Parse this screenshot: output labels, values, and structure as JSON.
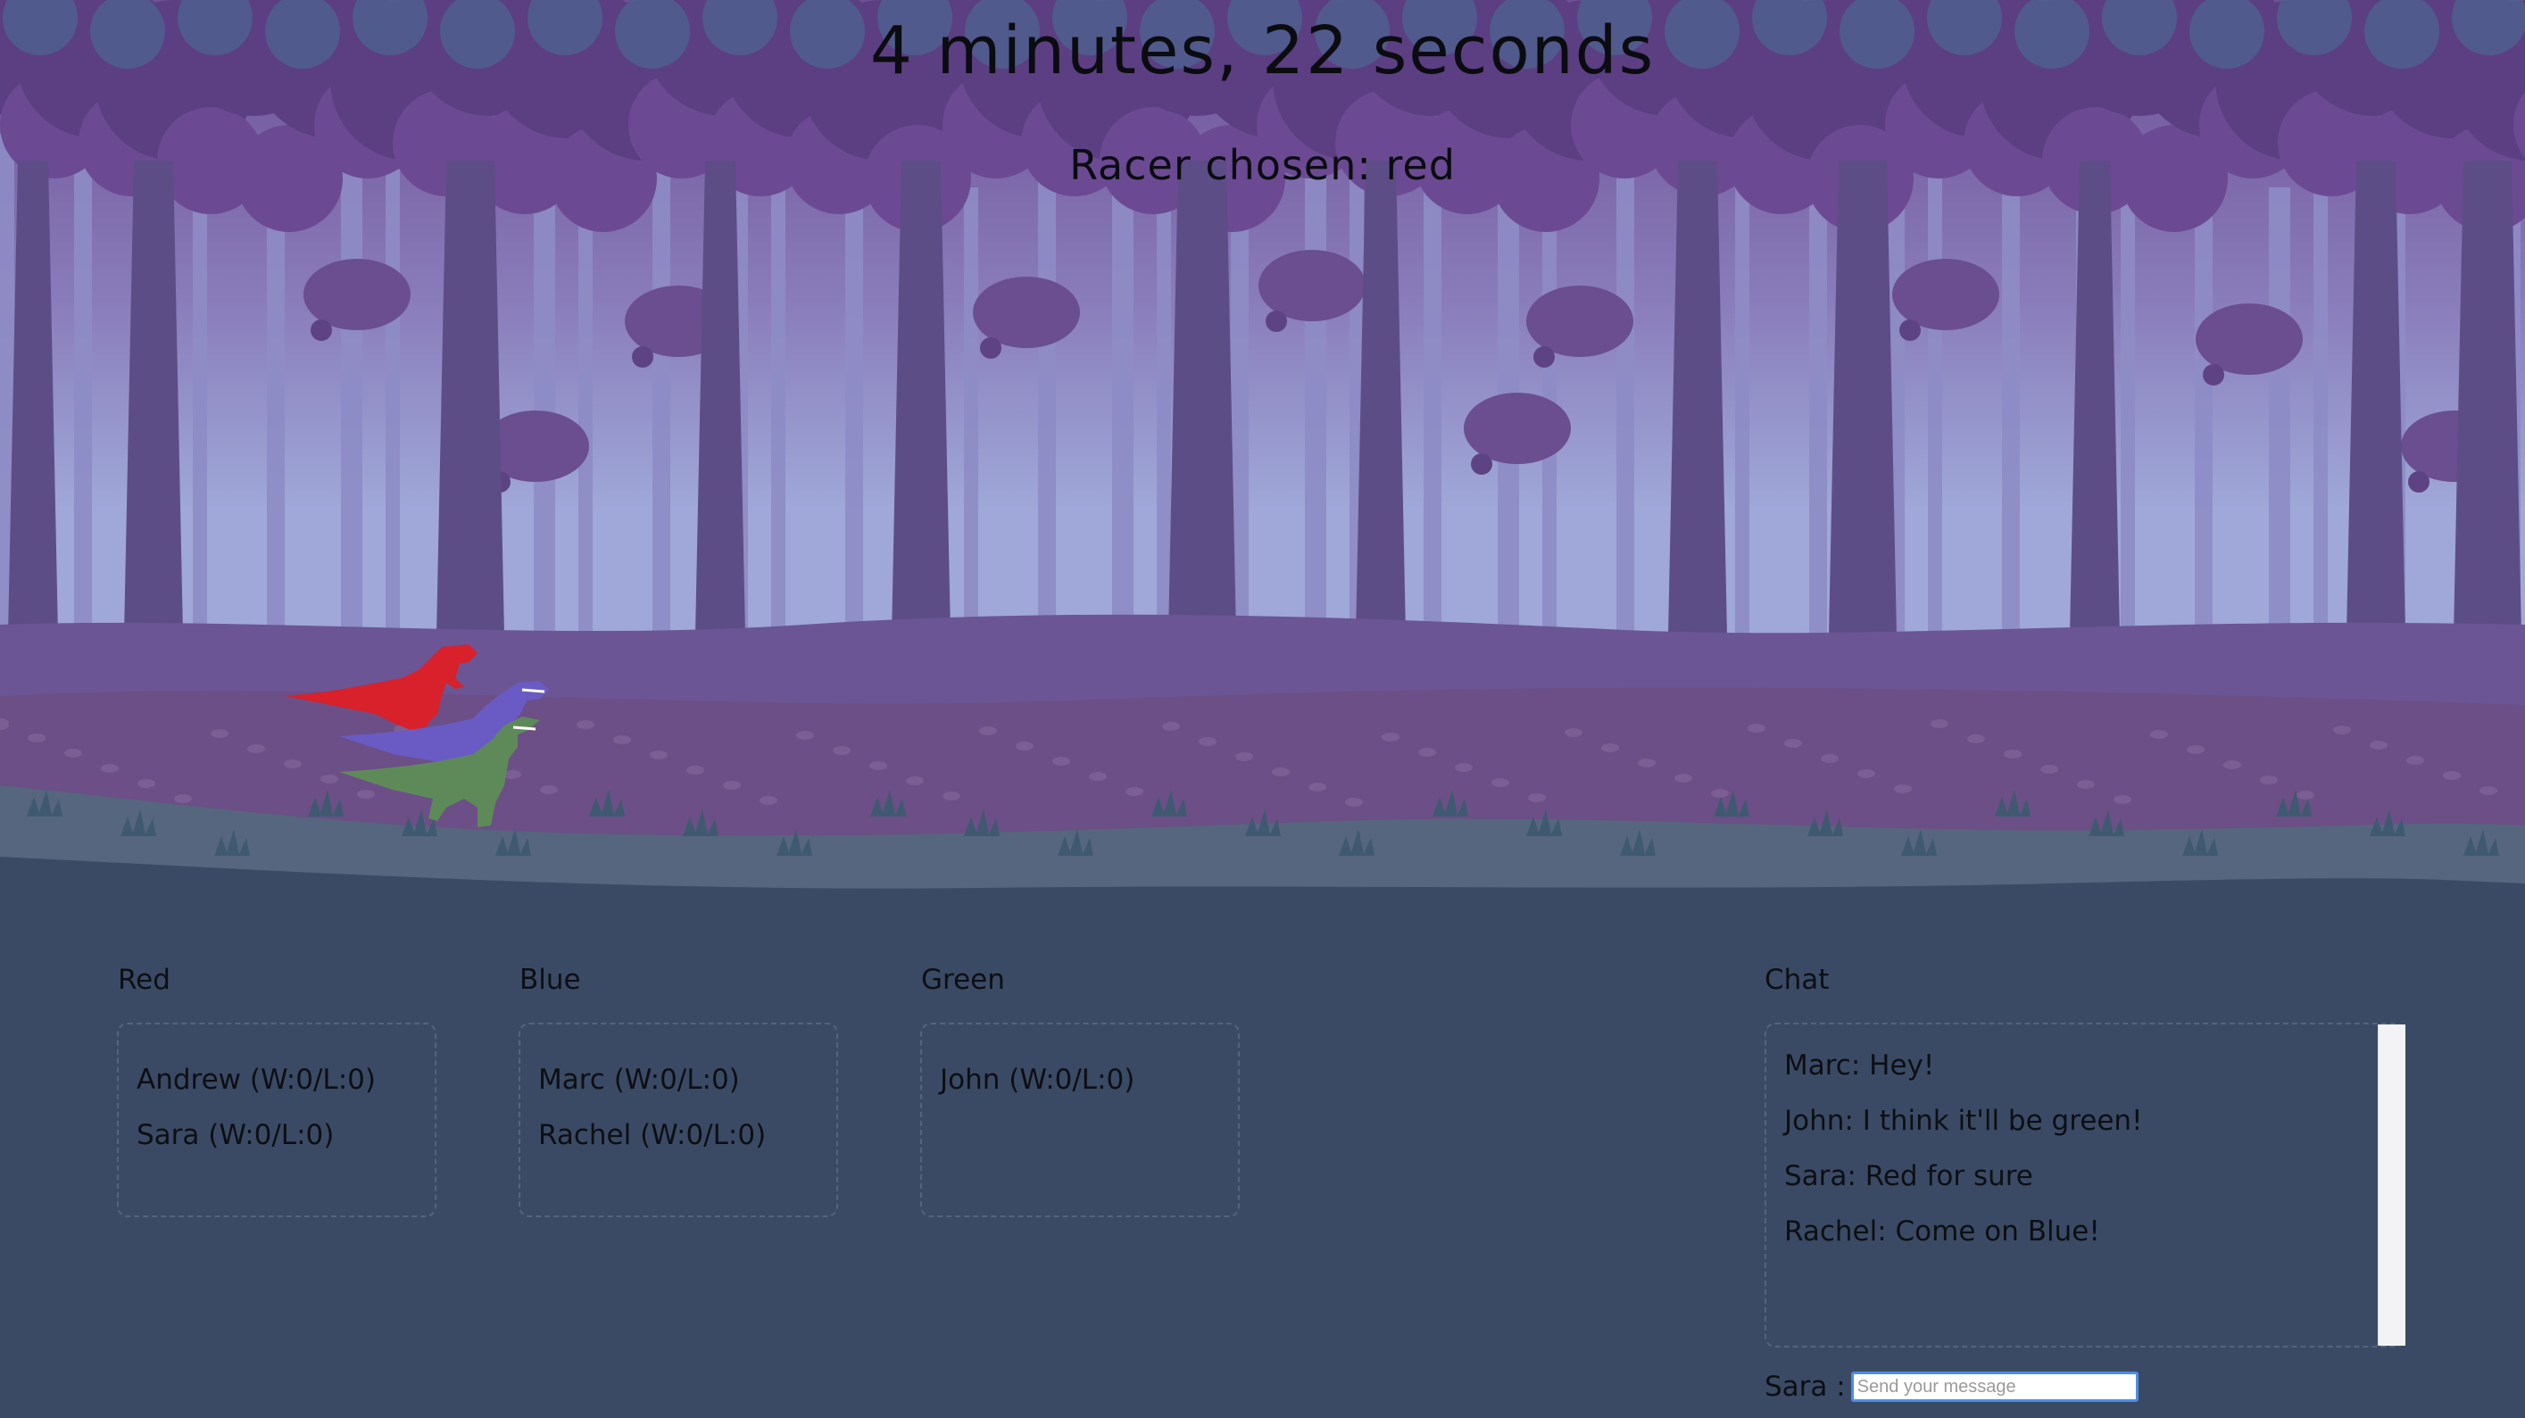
{
  "game": {
    "timer": "4 minutes, 22 seconds",
    "racer_chosen": "Racer chosen: red"
  },
  "racers": [
    {
      "name": "red-dino-icon",
      "color": "#d8212a"
    },
    {
      "name": "blue-dino-icon",
      "color": "#6a5bc4"
    },
    {
      "name": "green-dino-icon",
      "color": "#5e8a5a"
    }
  ],
  "teams": [
    {
      "title": "Red",
      "players": [
        "Andrew (W:0/L:0)",
        "Sara (W:0/L:0)"
      ]
    },
    {
      "title": "Blue",
      "players": [
        "Marc (W:0/L:0)",
        "Rachel (W:0/L:0)"
      ]
    },
    {
      "title": "Green",
      "players": [
        "John (W:0/L:0)"
      ]
    }
  ],
  "chat": {
    "title": "Chat",
    "messages": [
      "Marc: Hey!",
      "John: I think it'll be green!",
      "Sara: Red for sure",
      "Rachel: Come on Blue!"
    ],
    "user_label": "Sara :",
    "input_placeholder": "Send your message",
    "input_value": ""
  },
  "colors": {
    "page_background": "#3b4a64",
    "input_focus": "#4c8ee6"
  }
}
